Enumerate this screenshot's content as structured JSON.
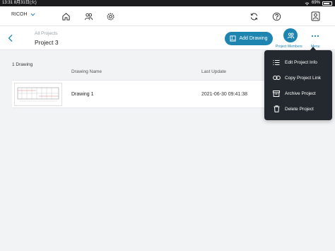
{
  "status_bar": {
    "time": "13:31",
    "date": "8月31日(火)",
    "battery": "69%"
  },
  "topbar": {
    "brand": "RICOH",
    "icons": [
      "home-icon",
      "people-icon",
      "gear-icon",
      "sync-icon",
      "help-icon",
      "account-icon"
    ]
  },
  "header": {
    "breadcrumb": "All Projects",
    "title": "Project 3",
    "add_drawing_label": "Add Drawing",
    "members_label": "Project Members",
    "menu_label": "Menu"
  },
  "list": {
    "count": "1 Drawing",
    "columns": {
      "name": "Drawing Name",
      "update": "Last Update"
    },
    "rows": [
      {
        "name": "Drawing 1",
        "last_update": "2021-06-30 09:41:38"
      }
    ]
  },
  "menu": {
    "items": [
      {
        "label": "Edit Project Info",
        "icon": "list-icon"
      },
      {
        "label": "Copy Project Link",
        "icon": "link-icon"
      },
      {
        "label": "Archive Project",
        "icon": "archive-icon"
      },
      {
        "label": "Delete Project",
        "icon": "trash-icon"
      }
    ]
  },
  "colors": {
    "accent": "#1e85b0",
    "menu_bg": "#23292f",
    "background": "#f2f3f5"
  }
}
